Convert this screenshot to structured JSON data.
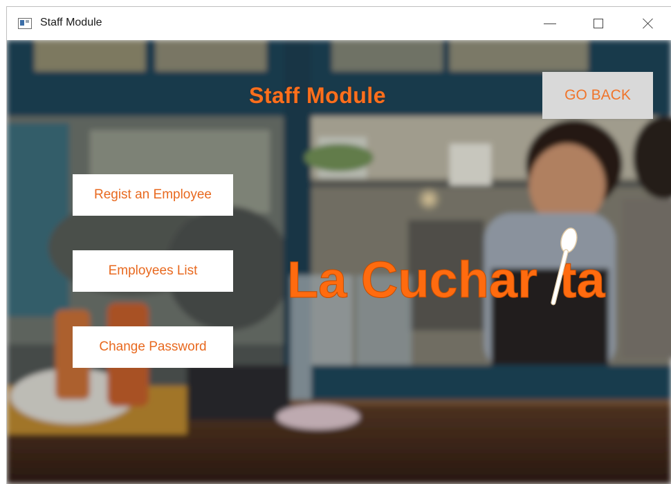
{
  "window": {
    "title": "Staff Module",
    "icon": "app-window-icon",
    "controls": {
      "minimize": "minimize-icon",
      "maximize": "maximize-icon",
      "close": "close-icon"
    }
  },
  "header": {
    "title": "Staff Module",
    "go_back_label": "GO BACK"
  },
  "menu": {
    "items": [
      {
        "label": "Regist an Employee"
      },
      {
        "label": "Employees List"
      },
      {
        "label": "Change Password"
      }
    ]
  },
  "logo": {
    "text_part1": "La Cuchar",
    "text_part2": "ta",
    "icon": "spoon-icon"
  },
  "colors": {
    "accent": "#ff6f1c",
    "button_text": "#e8691f",
    "go_back_bg": "#d9d9d9"
  }
}
